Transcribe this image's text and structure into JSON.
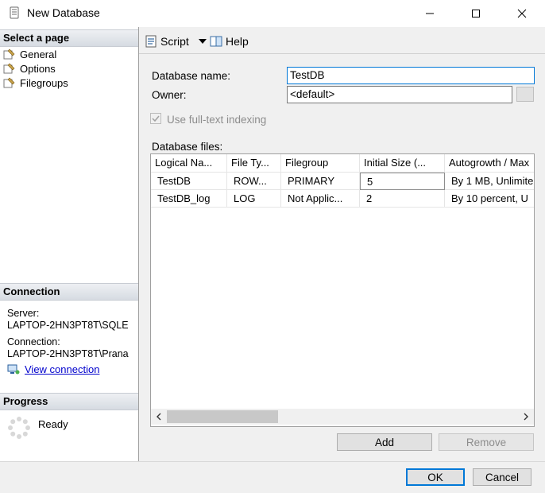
{
  "window": {
    "title": "New Database"
  },
  "left_pane": {
    "select_page_header": "Select a page",
    "pages": [
      {
        "label": "General"
      },
      {
        "label": "Options"
      },
      {
        "label": "Filegroups"
      }
    ],
    "connection_header": "Connection",
    "server_label": "Server:",
    "server_value": "LAPTOP-2HN3PT8T\\SQLE",
    "connection_label": "Connection:",
    "connection_value": "LAPTOP-2HN3PT8T\\Prana",
    "view_connection": "View connection",
    "progress_header": "Progress",
    "progress_status": "Ready"
  },
  "toolbar": {
    "script_label": "Script",
    "help_label": "Help"
  },
  "form": {
    "database_name_label": "Database name:",
    "database_name_value": "TestDB",
    "owner_label": "Owner:",
    "owner_value": "<default>",
    "fulltext_label": "Use full-text indexing",
    "fulltext_checked": true,
    "database_files_label": "Database files:"
  },
  "grid": {
    "columns": [
      "Logical Na...",
      "File Ty...",
      "Filegroup",
      "Initial Size (...",
      "Autogrowth / Max"
    ],
    "rows": [
      [
        "TestDB",
        "ROW...",
        "PRIMARY",
        "5",
        "By 1 MB, Unlimite"
      ],
      [
        "TestDB_log",
        "LOG",
        "Not Applic...",
        "2",
        "By 10 percent, U"
      ]
    ]
  },
  "buttons": {
    "add": "Add",
    "remove": "Remove",
    "ok": "OK",
    "cancel": "Cancel"
  },
  "colors": {
    "accent": "#0078d7",
    "link": "#0000cc"
  }
}
